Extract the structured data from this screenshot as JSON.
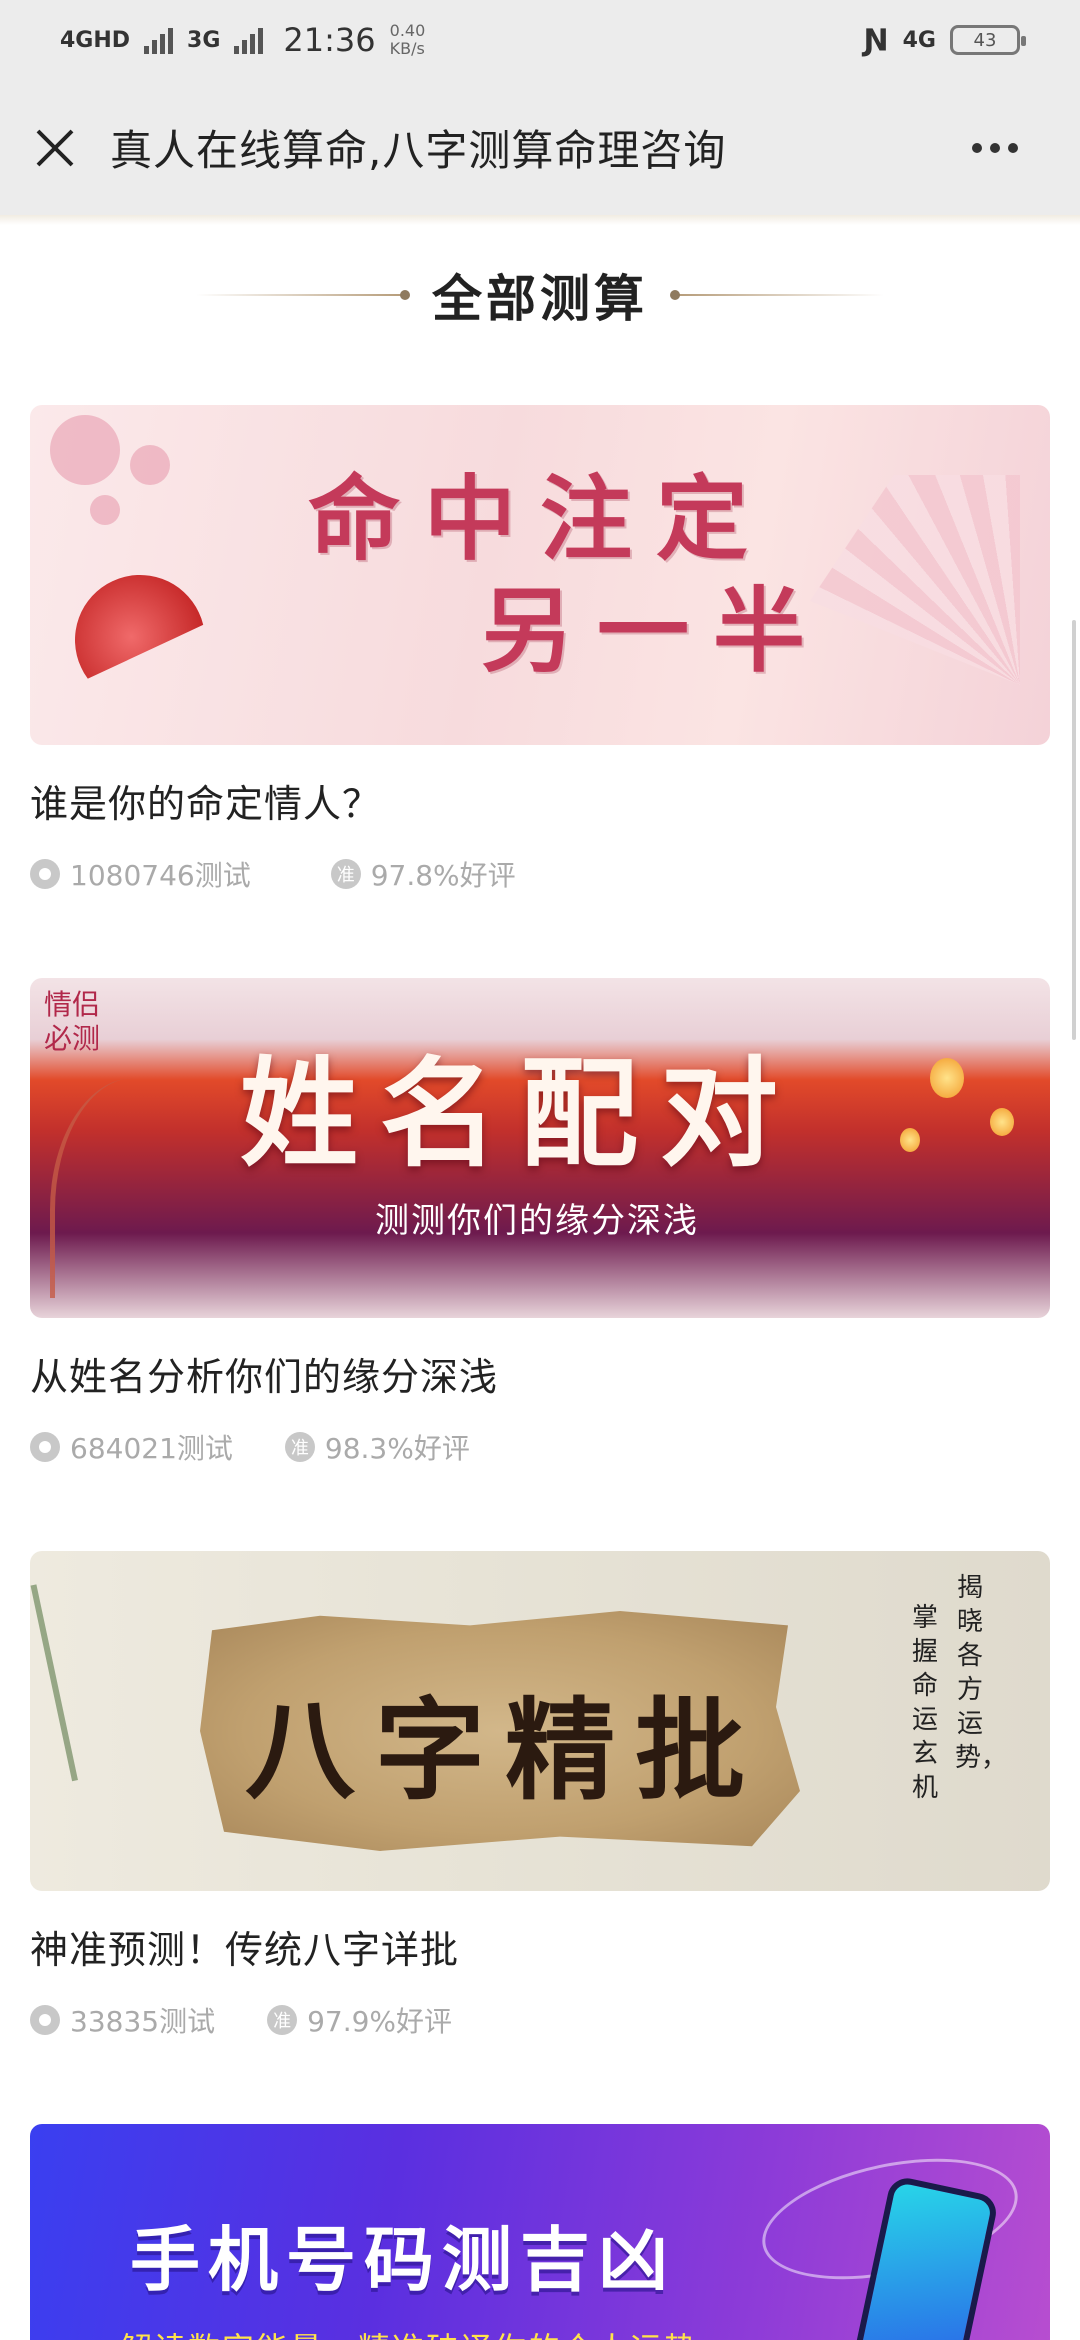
{
  "status_bar": {
    "network_1": "4GHD",
    "network_2": "3G",
    "time": "21:36",
    "speed_value": "0.40",
    "speed_unit": "KB/s",
    "network_right": "4G",
    "battery": "43"
  },
  "header": {
    "title": "真人在线算命,八字测算命理咨询"
  },
  "section": {
    "title": "全部测算"
  },
  "cards": [
    {
      "banner_line1": "命中注定",
      "banner_line2": "另一半",
      "title": "谁是你的命定情人？",
      "tests": "1080746测试",
      "rating": "97.8%好评",
      "rating_badge": "准"
    },
    {
      "banner_tag_line1": "情侣",
      "banner_tag_line2": "必测",
      "banner_main": "姓名配对",
      "banner_sub": "测测你们的缘分深浅",
      "title": "从姓名分析你们的缘分深浅",
      "tests": "684021测试",
      "rating": "98.3%好评",
      "rating_badge": "准"
    },
    {
      "banner_main": "八字精批",
      "banner_vert_1": "掌握命运玄机",
      "banner_vert_2": "揭晓各方运势，",
      "title": "神准预测！传统八字详批",
      "tests": "33835测试",
      "rating": "97.9%好评",
      "rating_badge": "准"
    },
    {
      "banner_main": "手机号码测吉凶",
      "banner_sub": "解读数字能量，精准破译你的个人运势"
    }
  ],
  "colors": {
    "header_bg": "#ececec",
    "accent_gold": "#b59b78",
    "stats_gray": "#aaaaaa"
  },
  "icons": {
    "close": "close-icon",
    "more": "more-icon",
    "views": "eye-icon",
    "rating": "accuracy-badge-icon"
  }
}
